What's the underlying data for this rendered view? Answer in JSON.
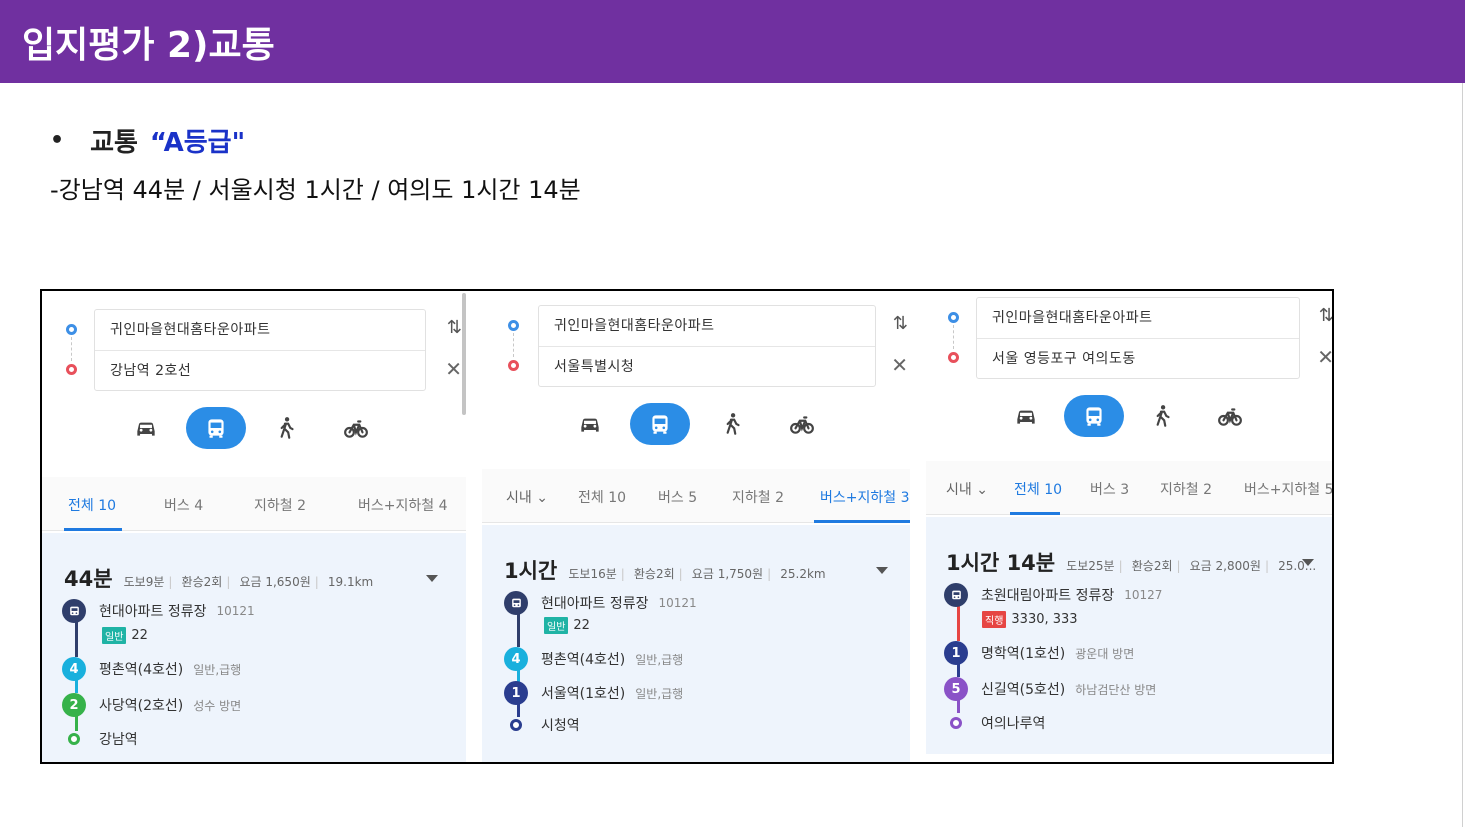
{
  "header": {
    "title": "입지평가 2)교통"
  },
  "bullet": {
    "dot": "•",
    "label": "교통",
    "grade": "“A등급\""
  },
  "subline": "-강남역 44분 / 서울시청 1시간 / 여의도 1시간 14분",
  "colors": {
    "header_bg": "#7030a0",
    "grade": "#1a32c8",
    "accent": "#2b8de6"
  },
  "icons": {
    "swap": "swap-icon",
    "close": "close-icon",
    "modes": [
      "car-icon",
      "bus-icon",
      "walk-icon",
      "bike-icon"
    ],
    "caret": "caret-down-icon"
  },
  "panels": [
    {
      "origin": "귀인마을현대홈타운아파트",
      "destination": "강남역 2호선",
      "swap": "⇅",
      "close": "✕",
      "tabs": [
        "전체 10",
        "버스 4",
        "지하철 2",
        "버스+지하철 4"
      ],
      "summary": {
        "time": "44분",
        "walk": "도보9분",
        "transfer": "환승2회",
        "fare": "요금 1,650원",
        "distance": "19.1km"
      },
      "steps": [
        {
          "name": "현대아파트 정류장",
          "sub": "10121"
        },
        {
          "name": "평촌역(4호선)",
          "sub": "일반,급행",
          "badge": "4"
        },
        {
          "name": "사당역(2호선)",
          "sub": "성수 방면",
          "badge": "2"
        },
        {
          "name": "강남역",
          "sub": ""
        }
      ],
      "bus": {
        "tag": "일반",
        "numbers": "22"
      }
    },
    {
      "origin": "귀인마을현대홈타운아파트",
      "destination": "서울특별시청",
      "swap": "⇅",
      "close": "✕",
      "filter": "시내 ⌄",
      "tabs": [
        "전체 10",
        "버스 5",
        "지하철 2",
        "버스+지하철 3"
      ],
      "summary": {
        "time": "1시간",
        "walk": "도보16분",
        "transfer": "환승2회",
        "fare": "요금 1,750원",
        "distance": "25.2km"
      },
      "steps": [
        {
          "name": "현대아파트 정류장",
          "sub": "10121"
        },
        {
          "name": "평촌역(4호선)",
          "sub": "일반,급행",
          "badge": "4"
        },
        {
          "name": "서울역(1호선)",
          "sub": "일반,급행",
          "badge": "1"
        },
        {
          "name": "시청역",
          "sub": ""
        }
      ],
      "bus": {
        "tag": "일반",
        "numbers": "22"
      }
    },
    {
      "origin": "귀인마을현대홈타운아파트",
      "destination": "서울 영등포구 여의도동",
      "swap": "⇅",
      "close": "✕",
      "filter": "시내 ⌄",
      "tabs": [
        "전체 10",
        "버스 3",
        "지하철 2",
        "버스+지하철 5"
      ],
      "summary": {
        "time": "1시간 14분",
        "walk": "도보25분",
        "transfer": "환승2회",
        "fare": "요금 2,800원",
        "distance": "25.0..."
      },
      "steps": [
        {
          "name": "초원대림아파트 정류장",
          "sub": "10127"
        },
        {
          "name": "명학역(1호선)",
          "sub": "광운대 방면",
          "badge": "1"
        },
        {
          "name": "신길역(5호선)",
          "sub": "하남검단산 방면",
          "badge": "5"
        },
        {
          "name": "여의나루역",
          "sub": ""
        }
      ],
      "bus": {
        "tag": "직행",
        "numbers": "3330, 333"
      }
    }
  ]
}
